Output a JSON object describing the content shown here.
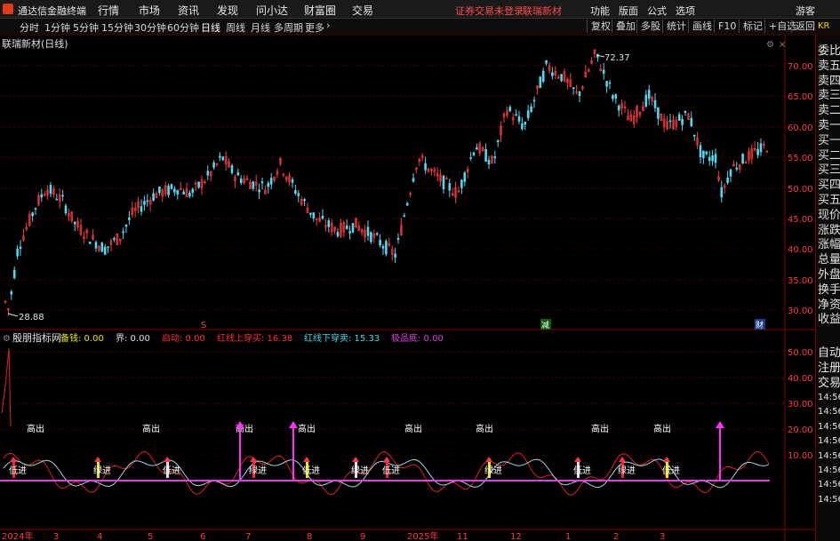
{
  "menubar": {
    "app_title": "通达信金融终端",
    "items": [
      "行情",
      "市场",
      "资讯",
      "发现",
      "问小达",
      "财富圈",
      "交易"
    ],
    "warning": "证券交易未登录",
    "stock": "联瑞新材",
    "right_items": [
      "功能",
      "版面",
      "公式",
      "选项"
    ],
    "guest": "游客"
  },
  "periods": [
    "分时",
    "1分钟",
    "5分钟",
    "15分钟",
    "30分钟",
    "60分钟",
    "日线",
    "周线",
    "月线",
    "多周期",
    "更多"
  ],
  "active_period": "日线",
  "toolbar_right": [
    "复权",
    "叠加",
    "多股",
    "统计",
    "画线",
    "F10",
    "标记",
    "+自选",
    "返回"
  ],
  "main_chart": {
    "title": "联瑞新材(日线)",
    "y_ticks": [
      "70.00",
      "65.00",
      "60.00",
      "55.00",
      "50.00",
      "45.00",
      "40.00",
      "35.00",
      "30.00"
    ],
    "high_label": "72.37",
    "low_label": "28.88",
    "marker_s": "S",
    "marker_jian": "减",
    "marker_cai": "财"
  },
  "indicator": {
    "name": "殷朋指标网",
    "vals": [
      {
        "label": "备钱:",
        "value": "0.00",
        "color": "#e8e800"
      },
      {
        "label": "界:",
        "value": "0.00",
        "color": "#e0e0e0"
      },
      {
        "label": "启动:",
        "value": "0.00",
        "color": "#ff3030"
      },
      {
        "label": "红线上穿买:",
        "value": "16.38",
        "color": "#ff3030"
      },
      {
        "label": "红线下穿卖:",
        "value": "15.33",
        "color": "#40d8e8"
      },
      {
        "label": "极品底:",
        "value": "0.00",
        "color": "#e040e0"
      }
    ],
    "y_ticks": [
      "50.00",
      "40.00",
      "30.00",
      "20.00",
      "10.00"
    ],
    "signal_high": "高出",
    "signal_low": "低进",
    "signal_low2": "绿进"
  },
  "xaxis": [
    "2024年",
    "3",
    "4",
    "5",
    "6",
    "7",
    "8",
    "9",
    "2025年",
    "11",
    "12",
    "1",
    "2",
    "3"
  ],
  "right_panel": [
    "委比",
    "卖五",
    "卖四",
    "卖三",
    "卖二",
    "卖一",
    "买一",
    "买二",
    "买三",
    "买四",
    "买五",
    "现价",
    "涨跌",
    "涨幅",
    "总量",
    "外盘",
    "换手",
    "净资",
    "收益"
  ],
  "right_panel_bottom": [
    "自动",
    "注册",
    "交易"
  ],
  "right_times": [
    "14:56",
    "14:56",
    "14:56",
    "14:56",
    "14:56",
    "14:56",
    "14:56",
    "14:56"
  ],
  "right_header": "KR",
  "colors": {
    "up": "#ff3b3b",
    "down": "#54d8f0",
    "grid": "#5a0000"
  }
}
